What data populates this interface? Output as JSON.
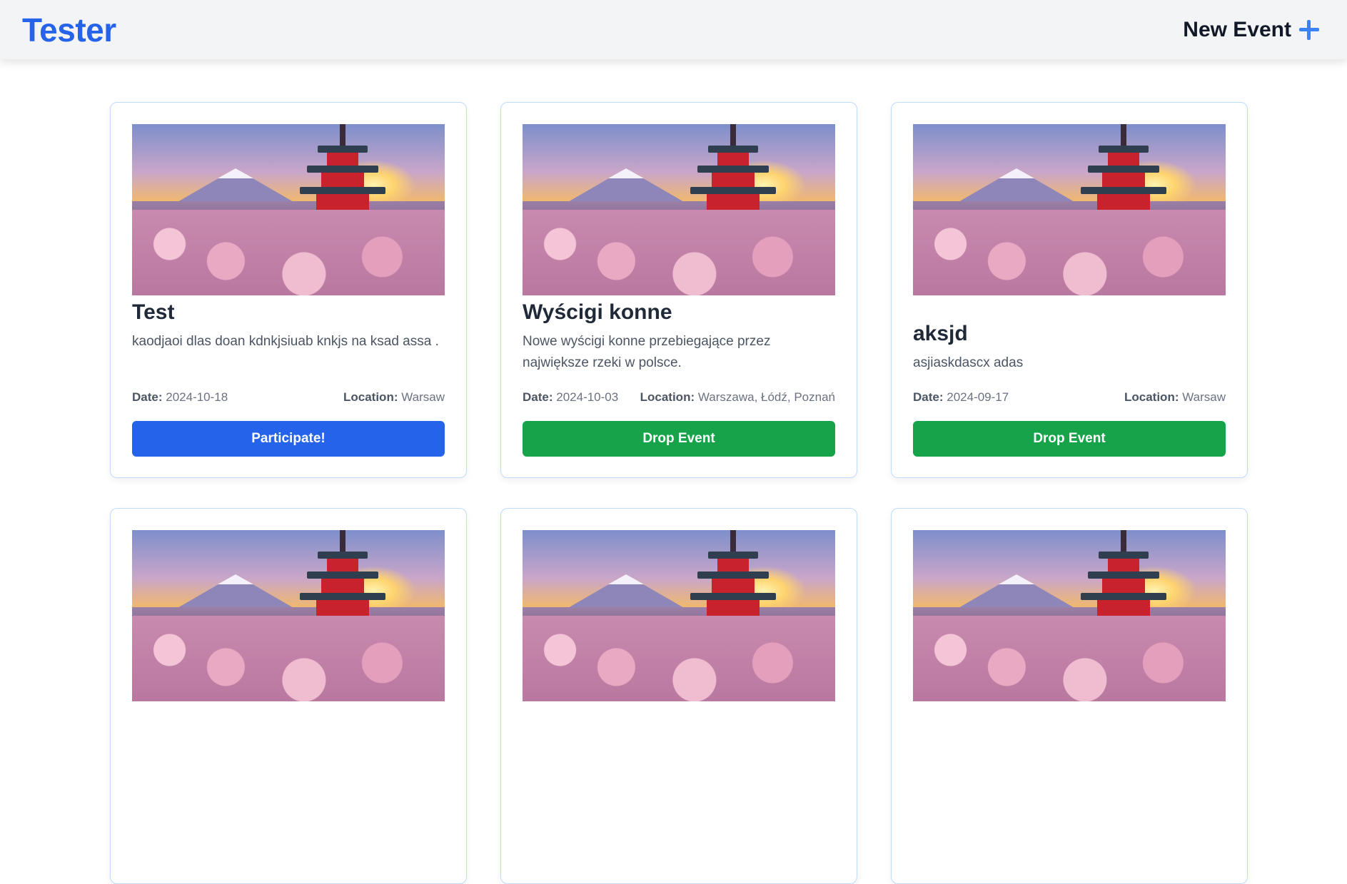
{
  "navbar": {
    "brand": "Tester",
    "new_event_label": "New Event"
  },
  "labels": {
    "date": "Date:",
    "location": "Location:"
  },
  "events": [
    {
      "title": "Test",
      "description": "kaodjaoi dlas doan kdnkjsiuab knkjs na ksad assa .",
      "date": "2024-10-18",
      "location": "Warsaw",
      "action": "Participate!"
    },
    {
      "title": "Wyścigi konne",
      "description": "Nowe wyścigi konne przebiegające przez największe rzeki w polsce.",
      "date": "2024-10-03",
      "location": "Warszawa, Łódź, Poznań",
      "action": "Drop Event"
    },
    {
      "title": "aksjd",
      "description": "asjiaskdascx adas",
      "date": "2024-09-17",
      "location": "Warsaw",
      "action": "Drop Event"
    }
  ],
  "colors": {
    "brand": "#2563eb",
    "participate": "#2563eb",
    "drop": "#16a34a"
  }
}
